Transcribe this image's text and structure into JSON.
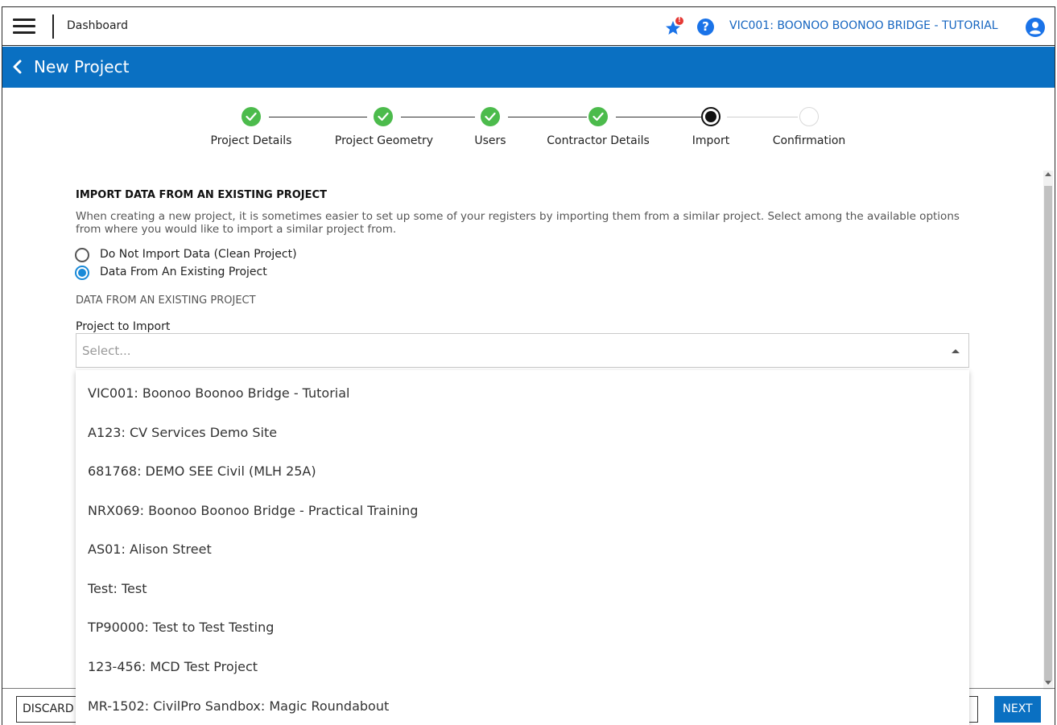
{
  "topbar": {
    "dashboard_label": "Dashboard",
    "notification_count": "!",
    "project_name": "VIC001: BOONOO BOONOO BRIDGE - TUTORIAL"
  },
  "header": {
    "title": "New Project"
  },
  "stepper": {
    "steps": [
      {
        "label": "Project Details",
        "state": "done"
      },
      {
        "label": "Project Geometry",
        "state": "done"
      },
      {
        "label": "Users",
        "state": "done"
      },
      {
        "label": "Contractor Details",
        "state": "done"
      },
      {
        "label": "Import",
        "state": "current"
      },
      {
        "label": "Confirmation",
        "state": "todo"
      }
    ]
  },
  "import": {
    "title": "IMPORT DATA FROM AN EXISTING PROJECT",
    "description": "When creating a new project, it is sometimes easier to set up some of your registers by importing them from a similar project. Select among the available options from where you would like to import a similar project from.",
    "options": [
      {
        "label": "Do Not Import Data (Clean Project)",
        "checked": false
      },
      {
        "label": "Data From An Existing Project",
        "checked": true
      }
    ],
    "subheading": "DATA FROM AN EXISTING PROJECT",
    "field_label": "Project to Import",
    "select_placeholder": "Select...",
    "dropdown_items": [
      "VIC001: Boonoo Boonoo Bridge - Tutorial",
      "A123: CV Services Demo Site",
      "681768: DEMO SEE Civil (MLH 25A)",
      "NRX069: Boonoo Boonoo Bridge - Practical Training",
      "AS01: Alison Street",
      "Test: Test",
      "TP90000: Test to Test Testing",
      "123-456: MCD Test Project",
      "MR-1502: CivilPro Sandbox: Magic Roundabout"
    ]
  },
  "footer": {
    "discard_label": "DISCARD",
    "next_label": "NEXT"
  },
  "colors": {
    "brand_blue": "#0a70c2",
    "step_done": "#4cbb4c",
    "radio_checked": "#1a8ad8",
    "link_blue": "#1565c0"
  }
}
